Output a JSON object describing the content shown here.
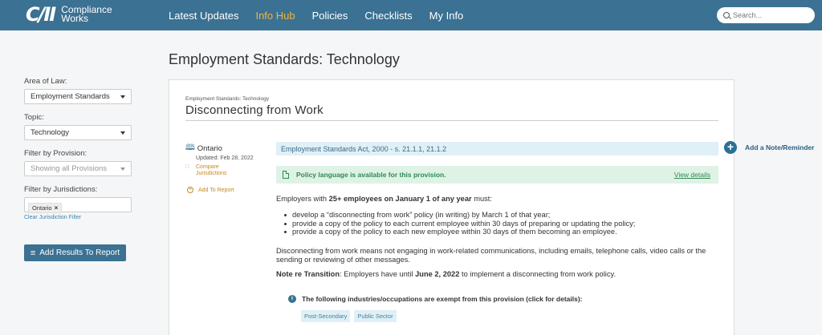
{
  "header": {
    "logo_mark": "C/II",
    "logo_line1": "Compliance",
    "logo_line2": "Works",
    "nav": [
      "Latest Updates",
      "Info Hub",
      "Policies",
      "Checklists",
      "My Info"
    ],
    "active_nav": "Info Hub",
    "search_placeholder": "Search...",
    "colors": {
      "bar": "#3b7192",
      "active": "#f2b53f"
    }
  },
  "sidebar": {
    "area_label": "Area of Law:",
    "area_value": "Employment Standards",
    "topic_label": "Topic:",
    "topic_value": "Technology",
    "provision_label": "Filter by Provision:",
    "provision_value": "Showing all Provisions",
    "jurisdictions_label": "Filter by Jurisdictions:",
    "jurisdiction_chip": "Ontario",
    "chip_remove": "×",
    "clear_link": "Clear Jurisdiction Filter",
    "add_results": "Add Results To Report"
  },
  "page": {
    "title": "Employment Standards: Technology"
  },
  "card": {
    "breadcrumb": "Employment Standards: Technology",
    "title": "Disconnecting from Work",
    "jurisdiction": "Ontario",
    "updated": "Updated: Feb 28, 2022",
    "compare_line1": "Compare",
    "compare_line2": "Jurisdictions",
    "add_to_report": "Add To Report",
    "act": "Employment Standards Act, 2000 - s. 21.1.1, 21.1.2",
    "alert_text": "Policy language is available for this provision.",
    "view_details": "View details",
    "intro_pre": "Employers with ",
    "intro_bold": "25+ employees on January 1 of any year",
    "intro_post": " must:",
    "bullets": [
      "develop a “disconnecting from work” policy (in writing) by March 1 of that year;",
      "provide a copy of the policy to each current employee within 30 days of preparing or updating the policy;",
      "provide a copy of the policy to each new employee within 30 days of them becoming an employee."
    ],
    "definition": "Disconnecting from work means not engaging in work-related communications, including emails, telephone calls, video calls or the sending or reviewing of other messages.",
    "note_label": "Note re Transition",
    "note_pre": ": Employers have until ",
    "note_date": "June 2, 2022",
    "note_post": " to implement a disconnecting from work policy.",
    "exempt_text": "The following industries/occupations are exempt from this provision (click for details):",
    "tags": [
      "Post-Secondary",
      "Public Sector"
    ]
  },
  "add_note": {
    "icon": "+",
    "label": "Add a Note/Reminder"
  },
  "icons": {
    "map": "🕮",
    "compare": "∷",
    "add_report": "+",
    "info": "i",
    "results": "≡"
  }
}
